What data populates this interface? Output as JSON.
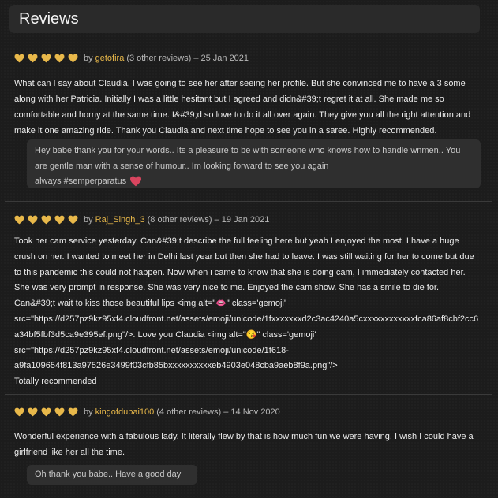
{
  "header": {
    "title": "Reviews"
  },
  "reviews": [
    {
      "author": "getofira",
      "other": "(3 other reviews)",
      "date": "– 25 Jan 2021",
      "by": "by",
      "lines": [
        "What can I say about Claudia. I was going to see her after seeing her profile. But she convinced me to have a 3 some",
        "along with her Patricia. Initially I was a little hesitant but I agreed and didn&#39;t regret it at all. She made me so",
        "comfortable and horny at the same time. I&#39;d so love to do it all over again. They give you all the right attention and",
        "make it one amazing ride. Thank you Claudia and next time hope to see you in a saree. Highly recommended."
      ],
      "reply_lines": [
        "Hey babe thank you for your words.. Its a pleasure to be with someone who knows how to handle wnmen.. You",
        "are gentle man with a sense of humour.. Im looking forward to see you again",
        "always #semperparatus"
      ]
    },
    {
      "author": "Raj_Singh_3",
      "other": "(8 other reviews)",
      "date": "– 19 Jan 2021",
      "by": "by",
      "lines": [
        "Took her cam service yesterday. Can&#39;t describe the full feeling here but yeah I enjoyed the most. I have a huge",
        "crush on her. I wanted to meet her in Delhi last year but then she had to leave. I was still waiting for her to come but due",
        "to this pandemic this could not happen. Now when i came to know that she is doing cam, I immediately contacted her.",
        "She was very prompt in response. She was very nice to me. Enjoyed the cam show. She has a smile to die for.",
        "Can&#39;t wait to kiss those beautiful lips <img alt=\"👄\" class='gemoji'",
        "src=\"https://d257pz9kz95xf4.cloudfront.net/assets/emoji/unicode/1fxxxxxxxd2c3ac4240a5cxxxxxxxxxxxxfca86af8cbf2cc6",
        "a34bf5fbf3d5ca9e395ef.png\"/>. Love you Claudia <img alt=\"😘\" class='gemoji'",
        "src=\"https://d257pz9kz95xf4.cloudfront.net/assets/emoji/unicode/1f618-",
        "a9fa109654f813a97526e3499f03cfb85bxxxxxxxxxxeb4903e048cba9aeb8f9a.png\"/>",
        "Totally recommended"
      ]
    },
    {
      "author": "kingofdubai100",
      "other": "(4 other reviews)",
      "date": "– 14 Nov 2020",
      "by": "by",
      "lines": [
        "Wonderful experience with a fabulous lady. It literally flew by that is how much fun we were having. I wish I could have a",
        "girlfriend like her all the time."
      ],
      "reply_lines": [
        "Oh thank you babe.. Have a good day"
      ]
    }
  ],
  "colors": {
    "star": "#e8b84a",
    "author": "#e8b84a",
    "reply_bg": "#2f2f2f",
    "heart": "#d9455f"
  },
  "icons": {
    "rating": "heart-rating-icon",
    "love": "red-heart-icon"
  }
}
